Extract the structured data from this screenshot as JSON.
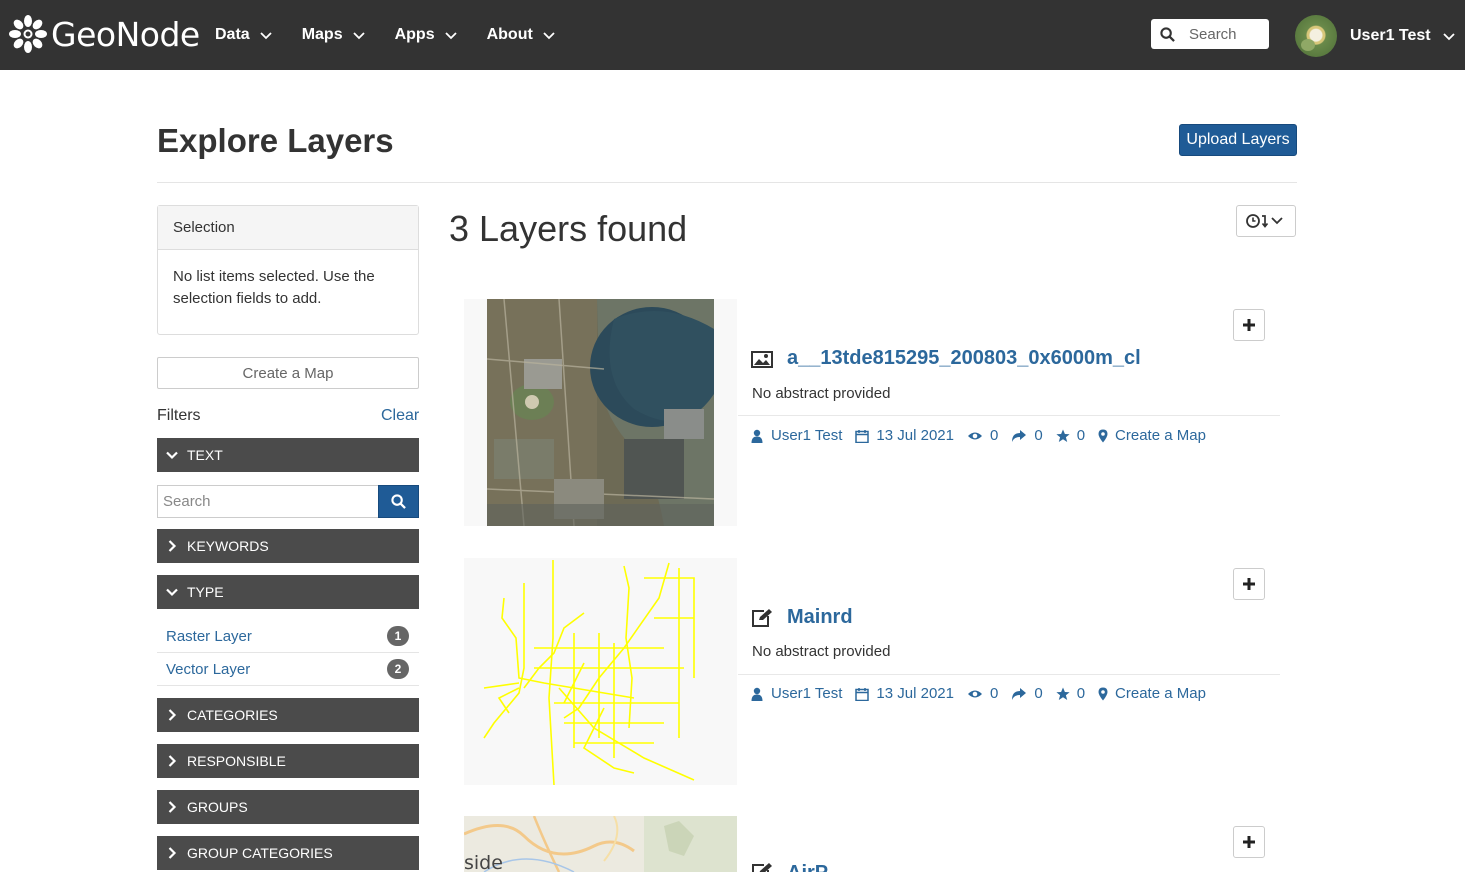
{
  "navbar": {
    "brand": "GeoNode",
    "menu": [
      {
        "label": "Data"
      },
      {
        "label": "Maps"
      },
      {
        "label": "Apps"
      },
      {
        "label": "About"
      }
    ],
    "search_placeholder": "Search",
    "user_name": "User1 Test"
  },
  "page": {
    "title": "Explore Layers",
    "upload_button": "Upload Layers"
  },
  "sidebar": {
    "selection_title": "Selection",
    "selection_body": "No list items selected. Use the selection fields to add.",
    "create_map": "Create a Map",
    "filters_label": "Filters",
    "clear_label": "Clear",
    "facets": {
      "text": "TEXT",
      "keywords": "KEYWORDS",
      "type": "TYPE",
      "categories": "CATEGORIES",
      "responsible": "RESPONSIBLE",
      "groups": "GROUPS",
      "group_categories": "GROUP CATEGORIES"
    },
    "text_search_placeholder": "Search",
    "type_options": [
      {
        "label": "Raster Layer",
        "count": "1"
      },
      {
        "label": "Vector Layer",
        "count": "2"
      }
    ]
  },
  "results": {
    "count_title": "3 Layers found",
    "cards": [
      {
        "title": "a__13tde815295_200803_0x6000m_cl",
        "type_icon": "image-icon",
        "abstract": "No abstract provided",
        "owner": "User1 Test",
        "date": "13 Jul 2021",
        "views": "0",
        "shares": "0",
        "rating": "0",
        "create_map": "Create a Map"
      },
      {
        "title": "Mainrd",
        "type_icon": "edit-icon",
        "abstract": "No abstract provided",
        "owner": "User1 Test",
        "date": "13 Jul 2021",
        "views": "0",
        "shares": "0",
        "rating": "0",
        "create_map": "Create a Map"
      },
      {
        "title": "AirP",
        "type_icon": "edit-icon",
        "thumb_text": "side"
      }
    ]
  },
  "colors": {
    "navbar_bg": "#333333",
    "primary": "#1f5b96",
    "link": "#2c689c",
    "facet_bg": "#4b4b4b"
  }
}
